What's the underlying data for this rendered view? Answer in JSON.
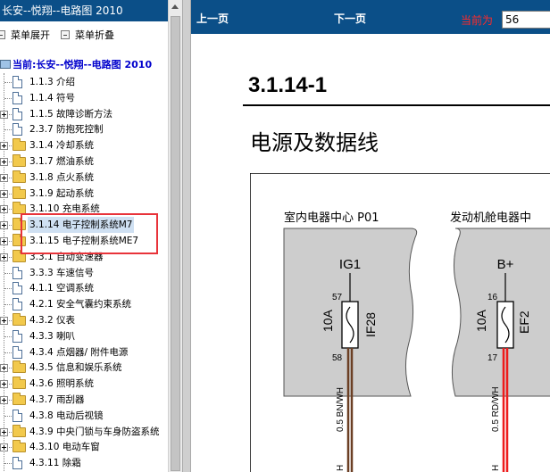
{
  "left": {
    "title": "长安--悦翔--电路图 2010",
    "menu": {
      "expand_label": "菜单展开",
      "collapse_label": "菜单折叠"
    },
    "tree": {
      "root_label": "当前:长安--悦翔--电路图 2010",
      "items": [
        {
          "label": "1.1.3 介绍",
          "icon": "document-icon",
          "expandable": false
        },
        {
          "label": "1.1.4 符号",
          "icon": "document-icon",
          "expandable": false
        },
        {
          "label": "1.1.5 故障诊断方法",
          "icon": "document-icon",
          "expandable": true
        },
        {
          "label": "2.3.7 防抱死控制",
          "icon": "document-icon",
          "expandable": false
        },
        {
          "label": "3.1.4 冷却系统",
          "icon": "folder-icon",
          "expandable": true
        },
        {
          "label": "3.1.7 燃油系统",
          "icon": "folder-icon",
          "expandable": true
        },
        {
          "label": "3.1.8 点火系统",
          "icon": "folder-icon",
          "expandable": true
        },
        {
          "label": "3.1.9 起动系统",
          "icon": "folder-icon",
          "expandable": true
        },
        {
          "label": "3.1.10 充电系统",
          "icon": "folder-icon",
          "expandable": true
        },
        {
          "label": "3.1.14 电子控制系统M7",
          "icon": "folder-icon",
          "expandable": true,
          "selected": true
        },
        {
          "label": "3.1.15 电子控制系统ME7",
          "icon": "folder-icon",
          "expandable": true
        },
        {
          "label": "3.3.1 自动变速器",
          "icon": "folder-icon",
          "expandable": true
        },
        {
          "label": "3.3.3 车速信号",
          "icon": "document-icon",
          "expandable": false
        },
        {
          "label": "4.1.1 空调系统",
          "icon": "document-icon",
          "expandable": false
        },
        {
          "label": "4.2.1 安全气囊约束系统",
          "icon": "document-icon",
          "expandable": false
        },
        {
          "label": "4.3.2 仪表",
          "icon": "folder-icon",
          "expandable": true
        },
        {
          "label": "4.3.3 喇叭",
          "icon": "document-icon",
          "expandable": false
        },
        {
          "label": "4.3.4 点烟器/ 附件电源",
          "icon": "document-icon",
          "expandable": false
        },
        {
          "label": "4.3.5 信息和娱乐系统",
          "icon": "folder-icon",
          "expandable": true
        },
        {
          "label": "4.3.6 照明系统",
          "icon": "folder-icon",
          "expandable": true
        },
        {
          "label": "4.3.7 雨刮器",
          "icon": "folder-icon",
          "expandable": true
        },
        {
          "label": "4.3.8 电动后视镜",
          "icon": "document-icon",
          "expandable": false
        },
        {
          "label": "4.3.9 中央门锁与车身防盗系统",
          "icon": "folder-icon",
          "expandable": true
        },
        {
          "label": "4.3.10 电动车窗",
          "icon": "folder-icon",
          "expandable": true
        },
        {
          "label": "4.3.11 除霜",
          "icon": "document-icon",
          "expandable": false
        }
      ]
    }
  },
  "right": {
    "toolbar": {
      "prev_label": "上一页",
      "next_label": "下一页",
      "current_label": "当前为",
      "page_value": "56"
    },
    "page_code": "3.1.14-1",
    "page_title": "电源及数据线",
    "diagram": {
      "left_box": {
        "title": "室内电器中心 P01",
        "supply": "IG1",
        "pin_top": "57",
        "pin_bottom": "58",
        "rating": "10A",
        "fuse_id": "IF28",
        "wire": "0.5 BN/WH",
        "wire_color": "#6b3f24"
      },
      "right_box": {
        "title": "发动机舱电器中",
        "supply": "B+",
        "pin_top": "16",
        "pin_bottom": "17",
        "rating": "10A",
        "fuse_id": "EF2",
        "wire": "0.5 RD/WH",
        "wire_color": "#ee1c1c"
      },
      "bottom_glyph": "H"
    }
  },
  "colors": {
    "header_bg": "#0b4f88",
    "highlight": "#e8333a",
    "selection_bg": "#cfe0f2",
    "box_gray": "#cdcdcd"
  }
}
